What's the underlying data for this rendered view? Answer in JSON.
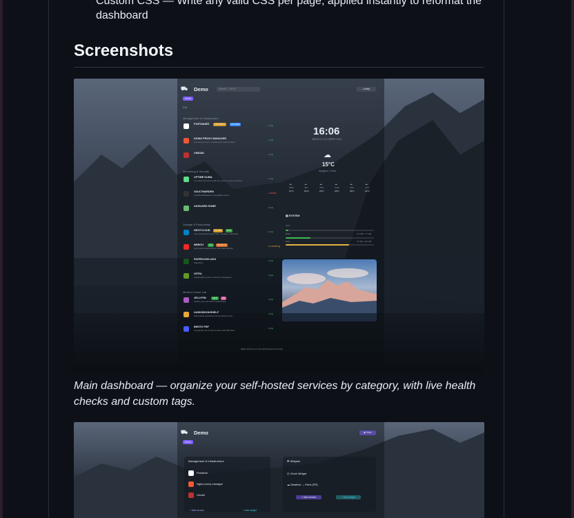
{
  "readme": {
    "prev_item": "Custom CSS — Write any valid CSS per page, applied instantly to reformat the",
    "prev_item_cont": "dashboard",
    "heading": "Screenshots",
    "caption": "Main dashboard — organize your self-hosted services by category, with live health checks and custom tags."
  },
  "shot1": {
    "app_name": "Demo",
    "search_placeholder": "Search... Ctrl+K",
    "theme_button": "Lonely",
    "page_tab": "Demo",
    "edit_label": "Edit",
    "clock": "16:06",
    "date": "MARDI 21 OCTOBRE 2025",
    "temperature": "15°C",
    "weather_desc": "Nuageux • Paris",
    "categories": [
      {
        "name": "Management & Infrastructure",
        "services": [
          {
            "name": "PORTAINER",
            "desc": "",
            "status": "up",
            "color": "#ffffff",
            "badges": [
              {
                "t": "UNSTABLE",
                "c": "#d29922"
              },
              {
                "t": "DOCKER",
                "c": "#388bfd"
              }
            ]
          },
          {
            "name": "NGINX PROXY MANAGER",
            "desc": "A reverse proxy to expose your web services",
            "status": "up",
            "color": "#f15833",
            "badges": []
          },
          {
            "name": "UNRAID",
            "desc": "",
            "status": "up",
            "color": "#c03030",
            "badges": []
          }
        ]
      },
      {
        "name": "Monitoring & Security",
        "services": [
          {
            "name": "UPTIME KUMA",
            "desc": "A monitoring tool to track the uptime of your services",
            "status": "up",
            "color": "#5cdd8b",
            "badges": []
          },
          {
            "name": "VAULTWARDEN",
            "desc": "Unofficial Bitwarden compatible server",
            "status": "down",
            "color": "#333333",
            "badges": []
          },
          {
            "name": "ADGUARD HOME",
            "desc": "",
            "status": "up",
            "color": "#68bc71",
            "badges": []
          }
        ]
      },
      {
        "name": "Storage & Productivity",
        "services": [
          {
            "name": "NEXTCLOUD",
            "desc": "Your self-hosted cloud: files, contacts, calendars",
            "status": "up",
            "color": "#0082c9",
            "badges": [
              {
                "t": "CLOUD",
                "c": "#d29922"
              },
              {
                "t": "FILE",
                "c": "#2ea043"
              }
            ]
          },
          {
            "name": "IMMICH",
            "desc": "High performance photo and video backup",
            "status": "checking",
            "color": "#fa2921",
            "badges": [
              {
                "t": "PH",
                "c": "#2ea043"
              },
              {
                "t": "BACKUP",
                "c": "#db6d28"
              }
            ]
          },
          {
            "name": "PAPERLESS-NGX",
            "desc": "Paperless",
            "status": "up",
            "color": "#17541f",
            "badges": []
          },
          {
            "name": "GITEA",
            "desc": "Lightweight source control for developers",
            "status": "up",
            "color": "#609926",
            "badges": []
          }
        ]
      },
      {
        "name": "Media & Home Lab",
        "services": [
          {
            "name": "JELLYFIN",
            "desc": "Stream your personal media library",
            "status": "up",
            "color": "#aa5cc3",
            "badges": [
              {
                "t": "MED",
                "c": "#2ea043"
              },
              {
                "t": "TV",
                "c": "#db61a2"
              }
            ]
          },
          {
            "name": "AUDIOBOOKSHELF",
            "desc": "Self-hosted audiobook and podcast server",
            "status": "up",
            "color": "#e8a838",
            "badges": []
          },
          {
            "name": "BENTO PDF",
            "desc": "A powerful set of tools to work with PDF files",
            "status": "up",
            "color": "#4a5cff",
            "badges": []
          }
        ]
      }
    ],
    "forecast": [
      {
        "day": "MER",
        "temp": "17°C"
      },
      {
        "day": "JEU",
        "temp": "16°C"
      },
      {
        "day": "VEN",
        "temp": "16°C"
      },
      {
        "day": "SAM",
        "temp": "16°C"
      },
      {
        "day": "DIM",
        "temp": "15°C"
      },
      {
        "day": "LUN",
        "temp": "14°C"
      }
    ],
    "system": {
      "title": "SYSTEM",
      "cpu_label": "CPU",
      "ram_label": "RAM",
      "disk_label": "Disk",
      "cpu_level": 0.03,
      "ram_level": 0.28,
      "disk_level": 0.72,
      "ram_value": "3.5 GB / 7.7 GB",
      "disk_value": "71 GB / 110 GB"
    },
    "footer": "Made with love for the self-hosting community"
  },
  "shot2": {
    "app_name": "Demo",
    "page_tab": "Demo",
    "view_button": "View",
    "category": "Management & Infrastructure",
    "services": [
      "Portainer",
      "Nginx proxy manager",
      "Unraid"
    ],
    "add_service": "+ Add service",
    "add_widget": "+ Add widget",
    "widgets_title": "Widgets",
    "widgets": [
      "Clock Widget",
      "Weather — Paris (FR)"
    ]
  },
  "colors": {
    "accent": "#7c5cff",
    "up": "#3fb950",
    "down": "#f85149",
    "bg": "#0d1117"
  }
}
